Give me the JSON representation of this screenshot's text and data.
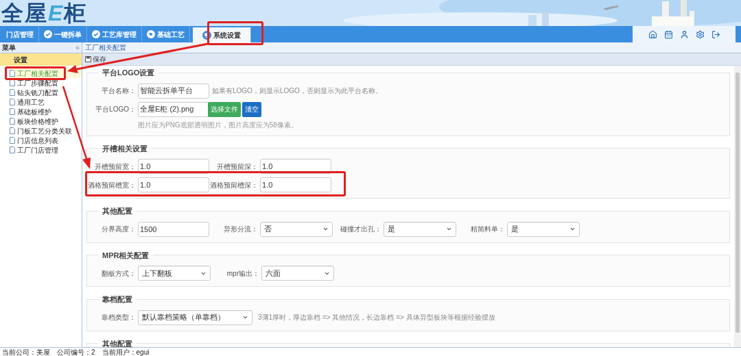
{
  "header": {
    "logo": [
      {
        "kind": "plain",
        "text": "全屋"
      },
      {
        "kind": "accent",
        "text": "E"
      },
      {
        "kind": "plain",
        "text": "柜"
      }
    ]
  },
  "nav_tabs": [
    {
      "label": "门店管理",
      "kind": "plain",
      "selected": false
    },
    {
      "label": "一键拆单",
      "kind": "check",
      "selected": false
    },
    {
      "label": "工艺库管理",
      "kind": "check",
      "selected": false
    },
    {
      "label": "基础工艺",
      "kind": "tag",
      "selected": false
    },
    {
      "label": "系统设置",
      "kind": "screen",
      "selected": true
    }
  ],
  "sidebar": {
    "title": "菜单",
    "collapse": "«",
    "group": "设置",
    "items": [
      {
        "label": "工厂相关配置",
        "selected": true
      },
      {
        "label": "工厂步骤配置",
        "selected": false
      },
      {
        "label": "钻头铣刀配置",
        "selected": false
      },
      {
        "label": "通用工艺",
        "selected": false
      },
      {
        "label": "基础板维护",
        "selected": false
      },
      {
        "label": "板块价格维护",
        "selected": false
      },
      {
        "label": "门板工艺分类关联",
        "selected": false
      },
      {
        "label": "门店信息列表",
        "selected": false
      },
      {
        "label": "工厂门店管理",
        "selected": false
      }
    ]
  },
  "breadcrumb": "工厂相关配置",
  "toolbar": {
    "save": "保存"
  },
  "sections": [
    {
      "title": "平台LOGO设置",
      "rows": [
        [
          {
            "label": "平台名称：",
            "kind": "text",
            "value": "智能云拆单平台",
            "note": "如果有LOGO，则显示LOGO，否则显示为此平台名称。"
          }
        ],
        [
          {
            "label": "平台LOGO：",
            "kind": "file",
            "value": "全屋E柜 (2).png",
            "buttons": [
              {
                "label": "选择文件",
                "kind": "primary"
              },
              {
                "label": "清空",
                "kind": "info"
              }
            ],
            "help": "图片应为PNG底部透明图片，图片高度应为58像素。"
          }
        ]
      ]
    },
    {
      "title": "开槽相关设置",
      "rows": [
        [
          {
            "label": "开槽预留宽：",
            "kind": "text",
            "value": "1.0"
          },
          {
            "label": "开槽预留深：",
            "kind": "text",
            "value": "1.0"
          }
        ],
        [
          {
            "label": "酒格预留槽宽：",
            "kind": "text",
            "value": "1.0"
          },
          {
            "label": "酒格预留槽深：",
            "kind": "text",
            "value": "1.0"
          }
        ]
      ]
    },
    {
      "title": "其他配置",
      "rows": [
        [
          {
            "label": "分界高度：",
            "kind": "text",
            "value": "1500"
          },
          {
            "label": "异形分流：",
            "kind": "select",
            "value": "否"
          },
          {
            "label": "碰撞才出孔：",
            "kind": "select",
            "value": "是"
          },
          {
            "label": "精简料单：",
            "kind": "select",
            "value": "是"
          }
        ]
      ]
    },
    {
      "title": "MPR相关配置",
      "rows": [
        [
          {
            "label": "翻板方式：",
            "kind": "select",
            "value": "上下翻板"
          },
          {
            "label": "mpr输出：",
            "kind": "select",
            "value": "六面"
          }
        ]
      ]
    },
    {
      "title": "靠档配置",
      "rows": [
        [
          {
            "label": "靠档类型：",
            "kind": "wideselect",
            "value": "默认靠档策略（单靠档）",
            "note": "3薄1厚时，厚边靠档 => 其他情况，长边靠档 => 具体异型板块等根据经验摆放"
          }
        ]
      ]
    },
    {
      "title": "其他配置"
    }
  ],
  "status_bar": [
    "当前公司：美屋",
    "公司编号：2",
    "当前用户：egui"
  ]
}
